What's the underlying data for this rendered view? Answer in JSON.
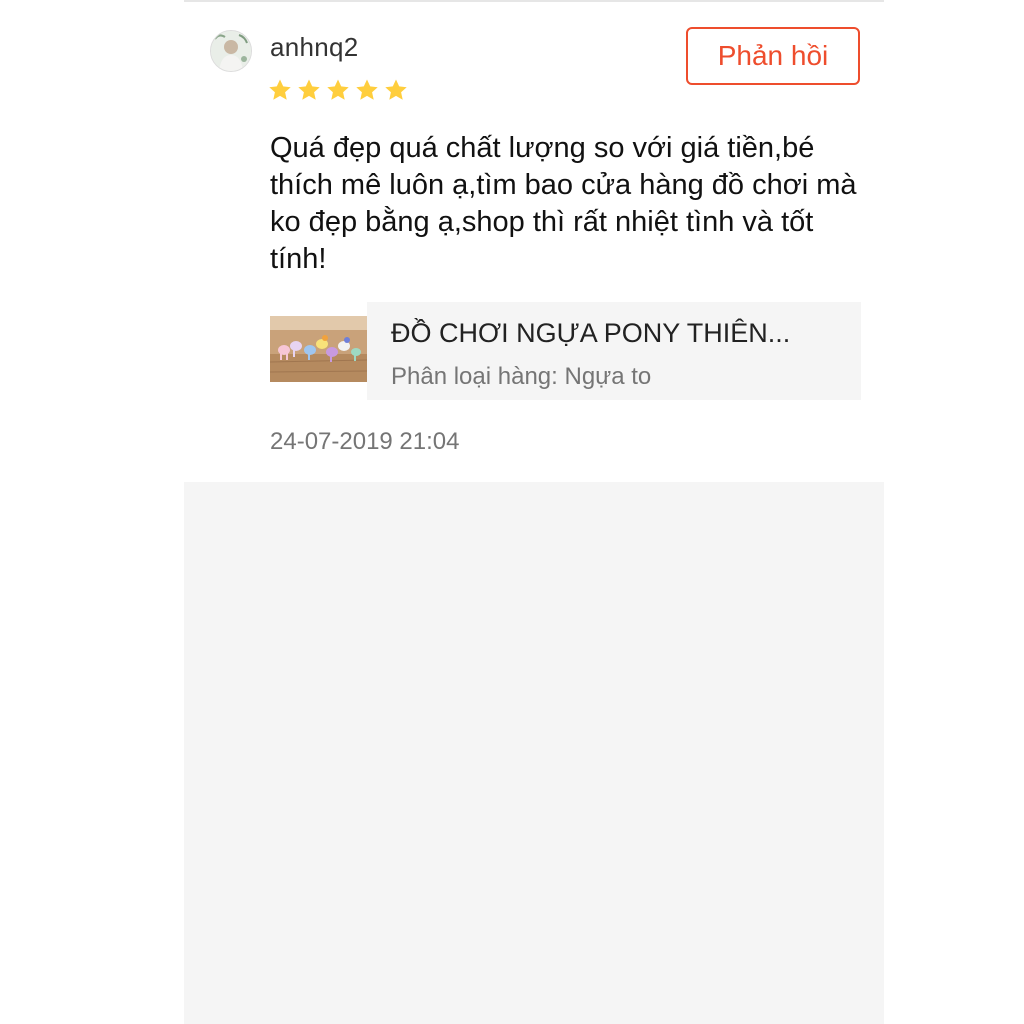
{
  "review": {
    "username": "anhnq2",
    "rating": 5,
    "rating_max": 5,
    "reply_label": "Phản hồi",
    "comment": "Quá đẹp quá chất lượng so với giá tiền,bé thích mê luôn ạ,tìm bao cửa hàng đồ chơi mà ko đẹp bằng ạ,shop thì rất nhiệt tình và tốt tính!",
    "product": {
      "name": "ĐỒ CHƠI NGỰA PONY THIÊN...",
      "variation_label": "Phân loại hàng:",
      "variation_value": "Ngựa to"
    },
    "timestamp": "24-07-2019 21:04"
  },
  "colors": {
    "accent": "#ee4d2d",
    "star": "#ffce3d",
    "product_bg": "#f5f5f5",
    "muted_text": "#757575"
  },
  "icons": {
    "avatar": "user-avatar",
    "star": "star-icon"
  }
}
